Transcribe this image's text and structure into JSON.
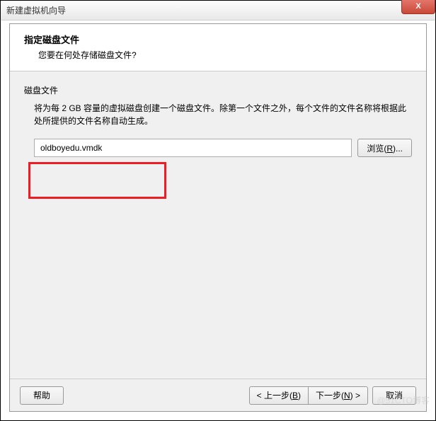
{
  "titlebar": {
    "title": "新建虚拟机向导",
    "close_label": "X"
  },
  "header": {
    "title": "指定磁盘文件",
    "subtitle": "您要在何处存储磁盘文件?"
  },
  "content": {
    "section_label": "磁盘文件",
    "description": "将为每 2 GB 容量的虚拟磁盘创建一个磁盘文件。除第一个文件之外，每个文件的文件名称将根据此处所提供的文件名称自动生成。",
    "input_value": "oldboyedu.vmdk",
    "browse_label": "浏览(",
    "browse_key": "R",
    "browse_suffix": ")..."
  },
  "footer": {
    "help_label": "帮助",
    "back_label": "< 上一步(",
    "back_key": "B",
    "back_suffix": ")",
    "next_label": "下一步(",
    "next_key": "N",
    "next_suffix": ") >",
    "cancel_label": "取消"
  },
  "watermark": "@51CTO博客"
}
